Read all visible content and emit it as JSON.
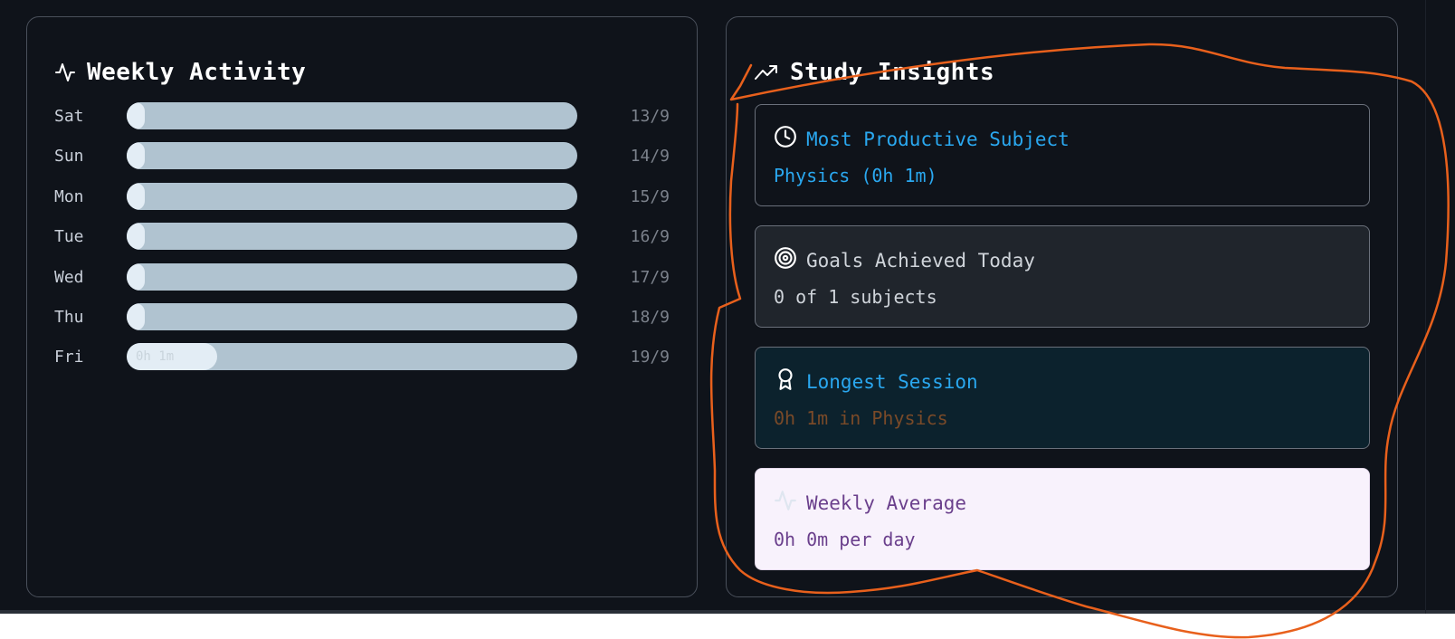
{
  "weekly_activity": {
    "title": "Weekly Activity",
    "icon": "activity-icon",
    "days": [
      {
        "day": "Sat",
        "date": "13/9",
        "label": "",
        "progress": 0.04
      },
      {
        "day": "Sun",
        "date": "14/9",
        "label": "",
        "progress": 0.04
      },
      {
        "day": "Mon",
        "date": "15/9",
        "label": "",
        "progress": 0.04
      },
      {
        "day": "Tue",
        "date": "16/9",
        "label": "",
        "progress": 0.04
      },
      {
        "day": "Wed",
        "date": "17/9",
        "label": "",
        "progress": 0.04
      },
      {
        "day": "Thu",
        "date": "18/9",
        "label": "",
        "progress": 0.04
      },
      {
        "day": "Fri",
        "date": "19/9",
        "label": "0h 1m",
        "progress": 0.2
      }
    ]
  },
  "study_insights": {
    "title": "Study Insights",
    "icon": "trending-up-icon",
    "cards": [
      {
        "title": "Most Productive Subject",
        "value": "Physics (0h 1m)",
        "icon": "clock-icon"
      },
      {
        "title": "Goals Achieved Today",
        "value": "0 of 1 subjects",
        "icon": "target-icon"
      },
      {
        "title": "Longest Session",
        "value": "0h 1m in Physics",
        "icon": "award-icon"
      },
      {
        "title": "Weekly Average",
        "value": "0h 0m per day",
        "icon": "activity-icon"
      }
    ]
  },
  "colors": {
    "background": "#0f131a",
    "accent_blue": "#2aa8f0",
    "bar_track": "#b0c3d0",
    "bar_fill": "#e3edf5",
    "annotation_stroke": "#e8601c"
  }
}
